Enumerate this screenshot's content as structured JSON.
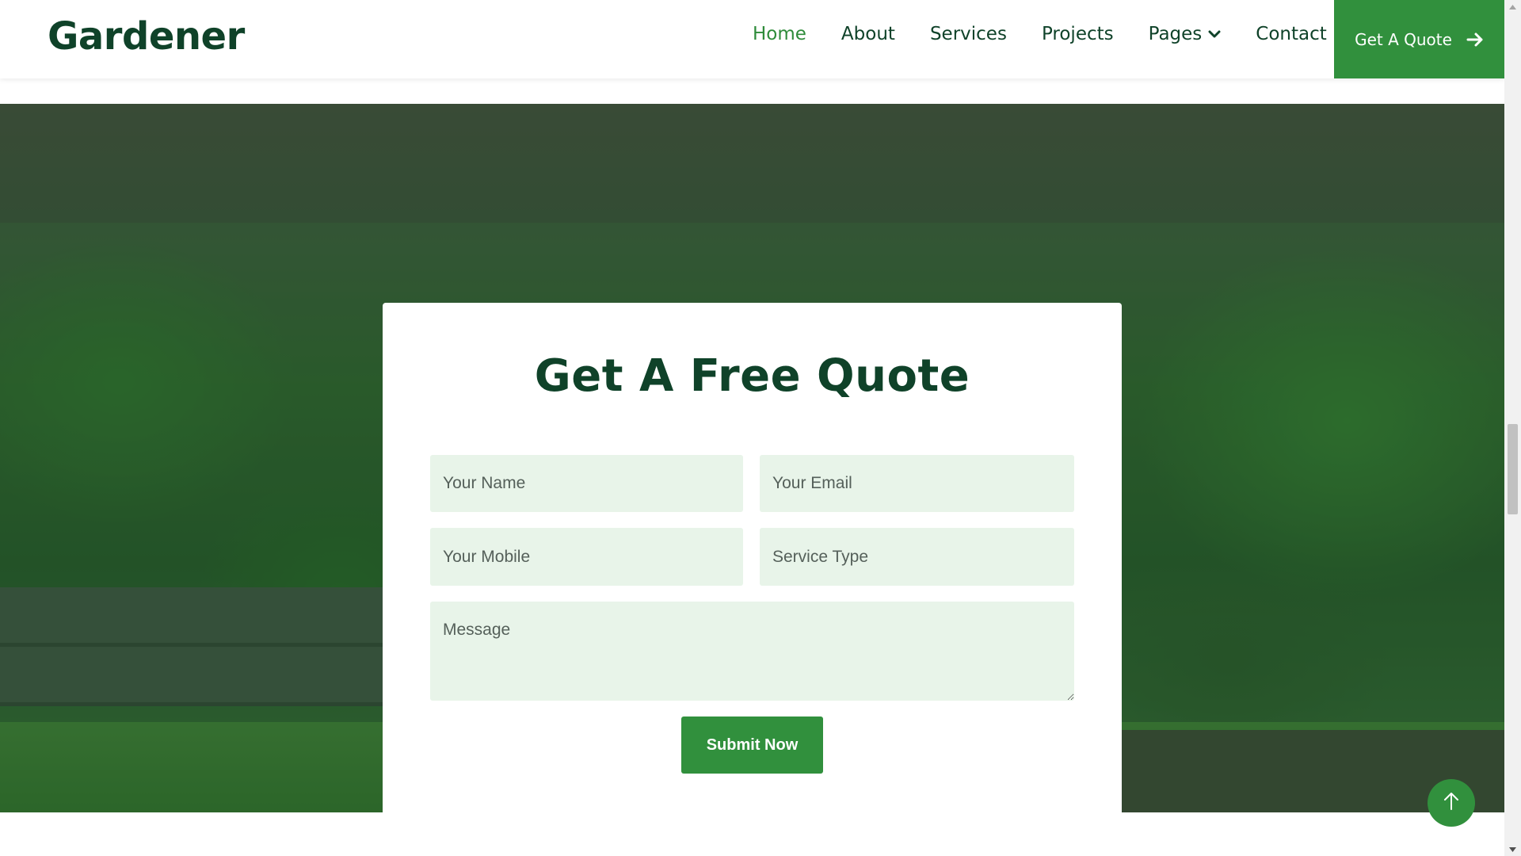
{
  "navbar": {
    "brand": "Gardener",
    "links": [
      {
        "label": "Home",
        "active": true
      },
      {
        "label": "About"
      },
      {
        "label": "Services"
      },
      {
        "label": "Projects"
      },
      {
        "label": "Pages",
        "has_dropdown": true
      },
      {
        "label": "Contact"
      }
    ],
    "cta_label": "Get A Quote",
    "cta_icon": "arrow-right-icon"
  },
  "quote_form": {
    "title": "Get A Free Quote",
    "name_placeholder": "Your Name",
    "email_placeholder": "Your Email",
    "mobile_placeholder": "Your Mobile",
    "service_placeholder": "Service Type",
    "message_placeholder": "Message",
    "submit_label": "Submit Now"
  },
  "back_to_top_icon": "arrow-up-icon",
  "colors": {
    "brand_dark": "#0f4229",
    "accent_green": "#31903d",
    "field_bg": "#e8f4e9"
  }
}
